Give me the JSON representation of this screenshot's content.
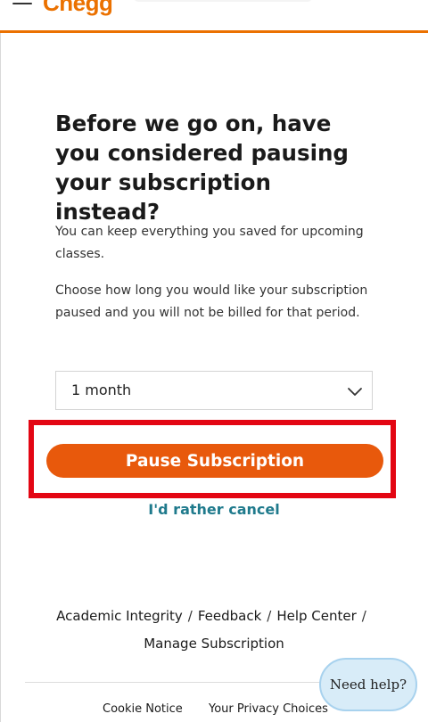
{
  "header": {
    "logo_text": "Chegg",
    "accent_color": "#eb7100",
    "menu_icon": "hamburger-menu-icon"
  },
  "main": {
    "heading": "Before we go on, have you considered pausing your subscription instead?",
    "paragraph_1": "You can keep everything you saved for upcoming classes.",
    "paragraph_2": "Choose how long you would like your subscription paused and you will not be billed for that period.",
    "duration_select": {
      "selected": "1 month",
      "icon": "chevron-down-icon"
    },
    "pause_button_label": "Pause Subscription",
    "cancel_link_label": "I'd rather cancel",
    "button_color": "#e8590c",
    "link_color": "#1f7a8c",
    "highlight_color": "#e30613"
  },
  "footer": {
    "links": [
      "Academic Integrity",
      "Feedback",
      "Help Center",
      "Manage Subscription"
    ],
    "separator": "/",
    "legal": {
      "cookie_notice": "Cookie Notice",
      "privacy_choices": "Your Privacy Choices"
    }
  },
  "help_widget": {
    "label": "Need help?"
  }
}
